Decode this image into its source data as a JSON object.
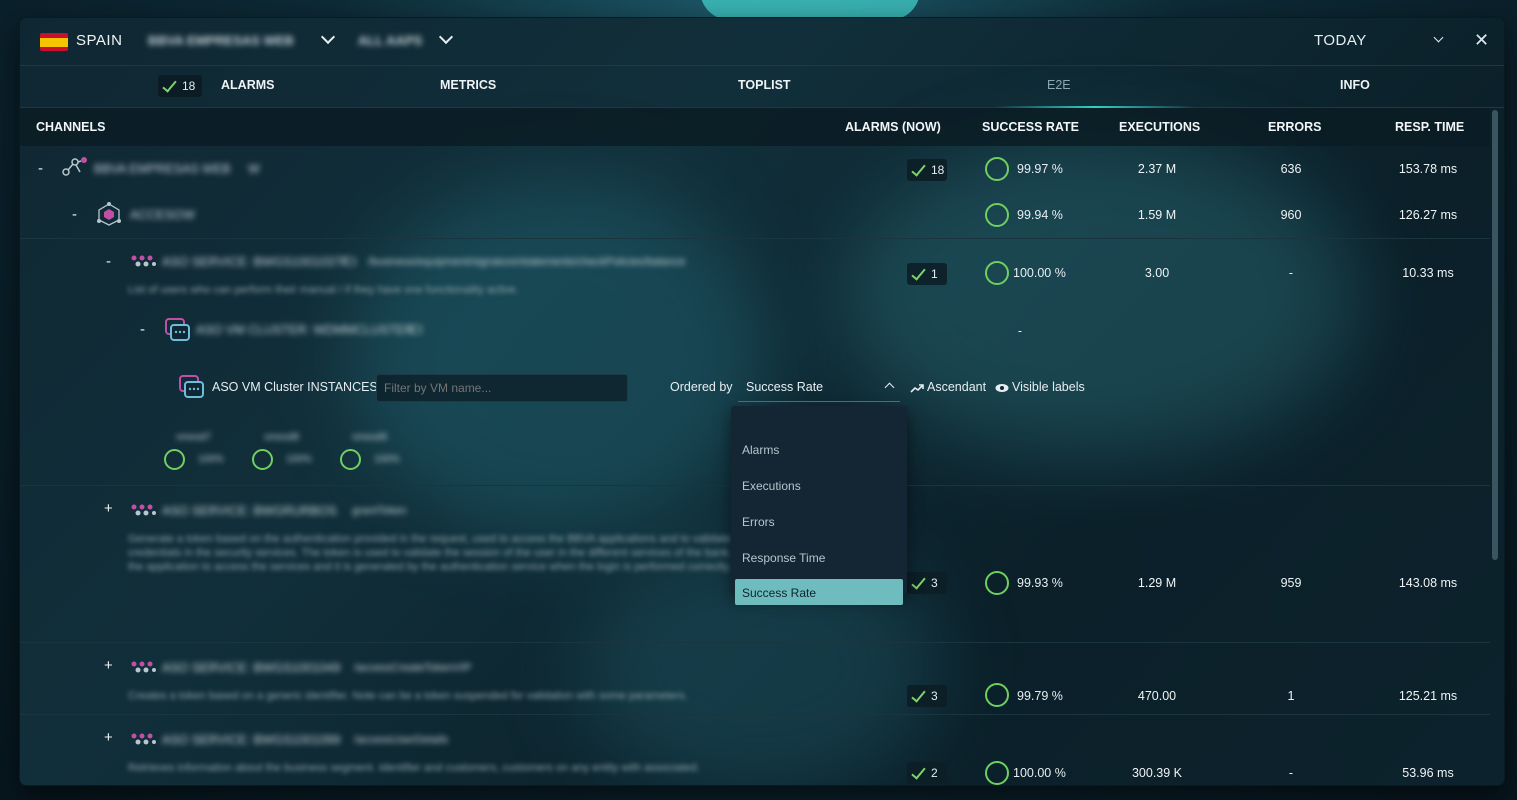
{
  "header": {
    "country": "SPAIN",
    "selector_1": "BBVA EMPRESAS WEB",
    "selector_2": "ALL AAPS",
    "period": "TODAY"
  },
  "tabs": [
    {
      "label": "ALARMS",
      "count": "18"
    },
    {
      "label": "METRICS"
    },
    {
      "label": "TOPLIST"
    },
    {
      "label": "E2E"
    },
    {
      "label": "INFO"
    }
  ],
  "columns": {
    "channels": "CHANNELS",
    "alarms": "ALARMS (NOW)",
    "success": "SUCCESS RATE",
    "executions": "EXECUTIONS",
    "errors": "ERRORS",
    "resp": "RESP. TIME"
  },
  "rows": [
    {
      "toggle": "-",
      "name": "BBVA EMPRESAS WEB",
      "tag": "W",
      "alarms": "18",
      "success": "99.97 %",
      "executions": "2.37 M",
      "errors": "636",
      "resp": "153.78 ms"
    },
    {
      "toggle": "-",
      "name": "ACCESO",
      "tag": "W",
      "success": "99.94 %",
      "executions": "1.59 M",
      "errors": "960",
      "resp": "126.27 ms"
    },
    {
      "toggle": "-",
      "name": "ASO SERVICE: BWGS1001037F",
      "tag": "CI",
      "path": "/business/equipment/signature/statements/checkPolicies/balance",
      "desc": "List of users who can perform their manual / if they have one functionality active.",
      "alarms": "1",
      "success": "100.00 %",
      "executions": "3.00",
      "errors": "-",
      "resp": "10.33 ms"
    },
    {
      "toggle": "-",
      "name": "ASO VM CLUSTER: WDMMCLUSTER",
      "tag": "CI",
      "success": "-"
    },
    {
      "toggle": "+",
      "name": "ASO SERVICE: BWGRURBOS",
      "path": "grantToken",
      "desc": "Generate a token based on the authentication provided in the request, used to access the BBVA applications and to validate the user credentials in the security services. The token is used to validate the session of the user in the different services of the bank. It is used in the application to access the services and it is generated by the authentication service when the login is performed correctly.",
      "alarms": "3",
      "success": "99.93 %",
      "executions": "1.29 M",
      "errors": "959",
      "resp": "143.08 ms"
    },
    {
      "toggle": "+",
      "name": "ASO SERVICE: BWGS1001049",
      "path": "/accessCreateTokenVIP",
      "desc": "Creates a token based on a generic identifier. Note can be a token suspended for validation with some parameters.",
      "alarms": "3",
      "success": "99.79 %",
      "executions": "470.00",
      "errors": "1",
      "resp": "125.21 ms"
    },
    {
      "toggle": "+",
      "name": "ASO SERVICE: BWGS1001099",
      "path": "/accessUserDetails",
      "desc": "Retrieves information about the business segment. Identifier and customers, customers on any entity with associated.",
      "alarms": "2",
      "success": "100.00 %",
      "executions": "300.39 K",
      "errors": "-",
      "resp": "53.96 ms"
    }
  ],
  "instances": {
    "label": "ASO VM Cluster  INSTANCES",
    "filter_placeholder": "Filter by VM name...",
    "ordered_by_label": "Ordered by",
    "ordered_by_value": "Success Rate",
    "ascendant": "Ascendant",
    "visible_labels": "Visible labels",
    "options": [
      "Alarms",
      "Executions",
      "Errors",
      "Response Time",
      "Success Rate"
    ],
    "vms": [
      {
        "name": "vmesd7",
        "rate": "100%"
      },
      {
        "name": "vmesd8",
        "rate": "100%"
      },
      {
        "name": "vmesd9",
        "rate": "100%"
      }
    ]
  },
  "colors": {
    "ring": "#6fd05e",
    "accent": "#35d0c8",
    "selected_option": "#6fbcbe"
  }
}
